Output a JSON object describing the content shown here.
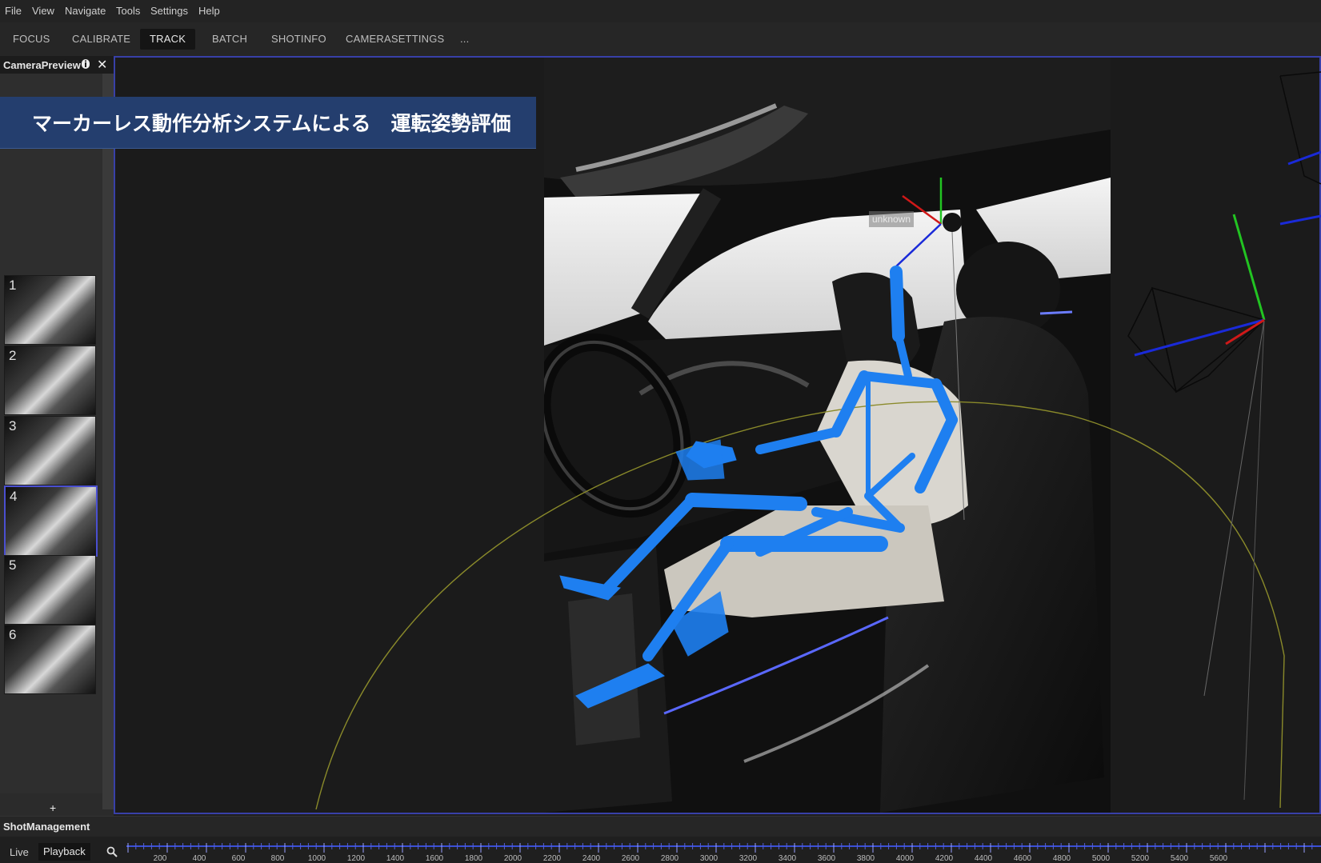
{
  "menu": [
    "File",
    "View",
    "Navigate",
    "Tools",
    "Settings",
    "Help"
  ],
  "tabs": [
    {
      "label": "FOCUS",
      "active": false
    },
    {
      "label": "CALIBRATE",
      "active": false
    },
    {
      "label": "TRACK",
      "active": true
    },
    {
      "label": "BATCH",
      "active": false
    },
    {
      "label": "SHOTINFO",
      "active": false
    },
    {
      "label": "CAMERASETTINGS",
      "active": false
    },
    {
      "label": "...",
      "active": false
    }
  ],
  "camera_preview": {
    "title": "CameraPreview",
    "info_icon": "info-icon",
    "close_icon": "close-icon",
    "thumbnails": [
      "1",
      "2",
      "3",
      "4",
      "5",
      "6"
    ],
    "selected_index": 3,
    "add_label": "+"
  },
  "banner": {
    "text": "マーカーレス動作分析システムによる　運転姿勢評価"
  },
  "viewport": {
    "subject_label": "unknown"
  },
  "shot_management": {
    "title": "ShotManagement",
    "live_label": "Live",
    "playback_label": "Playback",
    "search_icon": "search-icon",
    "timeline_ticks": [
      "200",
      "400",
      "600",
      "800",
      "1000",
      "1200",
      "1400",
      "1600",
      "1800",
      "2000",
      "2200",
      "2400",
      "2600",
      "2800",
      "3000",
      "3200",
      "3400",
      "3600",
      "3800",
      "4000",
      "4200",
      "4400",
      "4600",
      "4800",
      "5000",
      "5200",
      "5400",
      "5600"
    ]
  },
  "colors": {
    "accent_border": "#3840a8",
    "skeleton": "#1e7ff0",
    "banner_bg": "#243e6e",
    "axis_x": "#d01818",
    "axis_y": "#22c422",
    "axis_z": "#1a2ad8"
  }
}
